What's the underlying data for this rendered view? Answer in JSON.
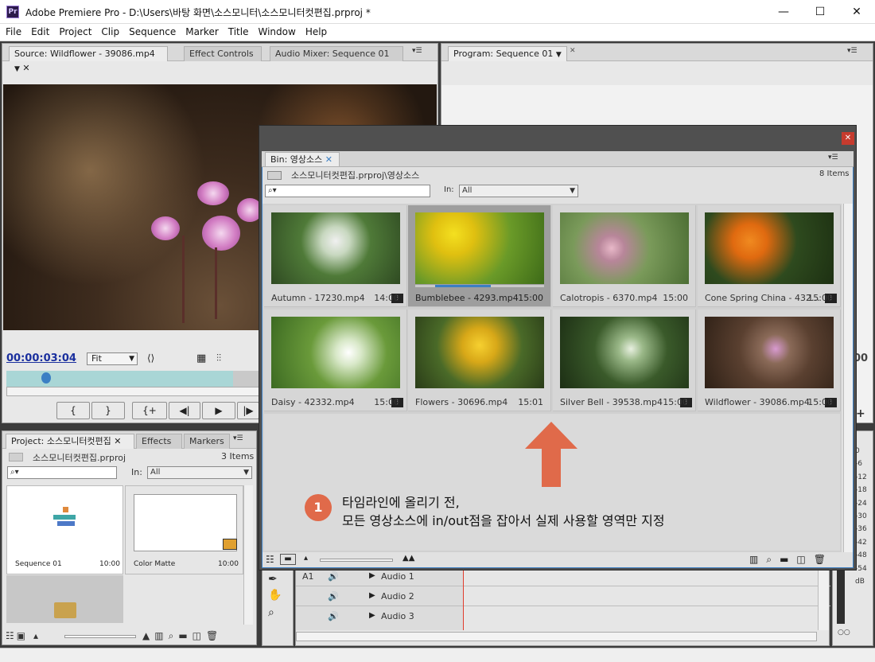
{
  "window": {
    "title": "Adobe Premiere Pro - D:\\Users\\바탕 화면\\소스모니터\\소스모니터컷편집.prproj *",
    "minimize": "—",
    "maximize": "☐",
    "close": "✕",
    "app_icon": "Pr"
  },
  "menu": [
    "File",
    "Edit",
    "Project",
    "Clip",
    "Sequence",
    "Marker",
    "Title",
    "Window",
    "Help"
  ],
  "source_panel": {
    "tabs": [
      "Source: Wildflower - 39086.mp4",
      "Effect Controls",
      "Audio Mixer: Sequence 01"
    ],
    "timecode": "00:00:03:04",
    "zoom": "Fit",
    "controls": [
      "{",
      "}",
      "{+",
      "◀|",
      "▶",
      "|▶"
    ]
  },
  "program_panel": {
    "tab": "Program: Sequence 01",
    "timecode_partial": "00"
  },
  "project_panel": {
    "tabs": [
      "Project: 소스모니터컷편집",
      "Effects",
      "Markers"
    ],
    "path": "소스모니터컷편집.prproj",
    "count": "3 Items",
    "in_label": "In:",
    "in_value": "All",
    "items": [
      {
        "name": "Sequence 01",
        "dur": "10:00"
      },
      {
        "name": "Color Matte",
        "dur": "10:00"
      }
    ]
  },
  "bin": {
    "tab": "Bin: 영상소스",
    "path": "소스모니터컷편집.prproj\\영상소스",
    "count": "8 Items",
    "in_label": "In:",
    "in_value": "All",
    "clips": [
      {
        "name": "Autumn - 17230.mp4",
        "dur": "14:00"
      },
      {
        "name": "Bumblebee - 4293.mp4",
        "dur": "15:00"
      },
      {
        "name": "Calotropis - 6370.mp4",
        "dur": "15:00"
      },
      {
        "name": "Cone Spring China - 432...",
        "dur": "15:00"
      },
      {
        "name": "Daisy - 42332.mp4",
        "dur": "15:00"
      },
      {
        "name": "Flowers - 30696.mp4",
        "dur": "15:01"
      },
      {
        "name": "Silver Bell - 39538.mp4",
        "dur": "15:00"
      },
      {
        "name": "Wildflower - 39086.mp4",
        "dur": "15:00"
      }
    ],
    "selected_index": 1
  },
  "annotation": {
    "number": "1",
    "line1": "타임라인에 올리기 전,",
    "line2": "모든 영상소스에 in/out점을 잡아서 실제 사용할 영역만 지정",
    "arrow_color": "#e06a4a"
  },
  "timeline": {
    "tracks": [
      "Audio 1",
      "Audio 2",
      "Audio 3"
    ],
    "track_ids": [
      "A1",
      "",
      ""
    ]
  },
  "meter": {
    "labels": [
      "0",
      "-6",
      "-12",
      "-18",
      "-24",
      "-30",
      "-36",
      "-42",
      "-48",
      "-54",
      "dB"
    ]
  },
  "colors": {
    "accent_blue": "#3b7fc4",
    "timecode_blue": "#1a2f9e",
    "annotation_orange": "#e06a4a"
  }
}
